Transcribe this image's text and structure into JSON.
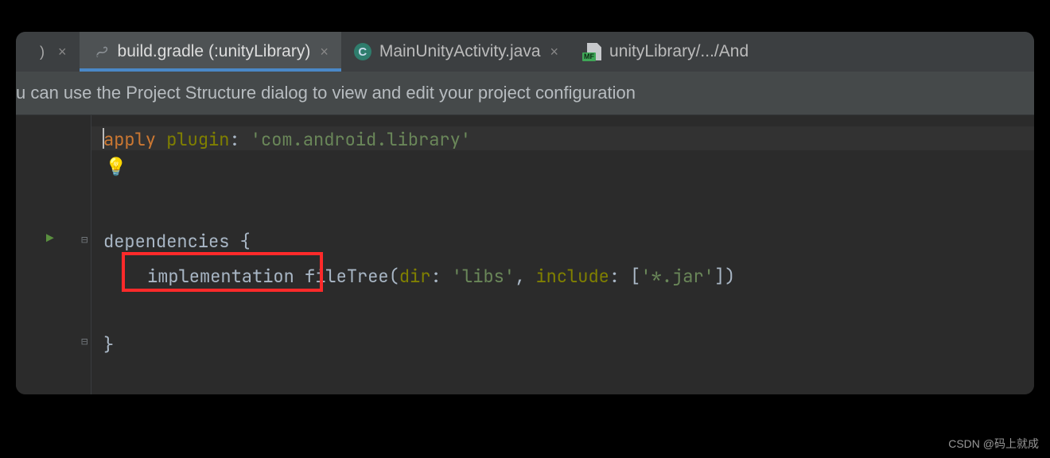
{
  "tabs": {
    "stub_paren": ")",
    "active": {
      "label": "build.gradle (:unityLibrary)"
    },
    "second": {
      "label": "MainUnityActivity.java",
      "icon_letter": "C"
    },
    "third": {
      "label": "unityLibrary/.../And",
      "mf_badge": "MF"
    }
  },
  "notification": "u can use the Project Structure dialog to view and edit your project configuration",
  "code": {
    "line1": {
      "apply": "apply",
      "plugin": "plugin",
      "colon": ": ",
      "str": "'com.android.library'"
    },
    "line3": {
      "dependencies": "dependencies",
      "brace": " {"
    },
    "line4": {
      "implementation": "implementation",
      "space": " ",
      "fileTree": "fileTree",
      "open": "(",
      "dir": "dir",
      "colon1": ": ",
      "libs": "'libs'",
      "comma": ", ",
      "include": "include",
      "colon2": ": ",
      "bracket_open": "[",
      "jar": "'*.jar'",
      "bracket_close": "]",
      "close": ")"
    },
    "line6": {
      "brace": "}"
    }
  },
  "watermark": "CSDN @码上就成"
}
